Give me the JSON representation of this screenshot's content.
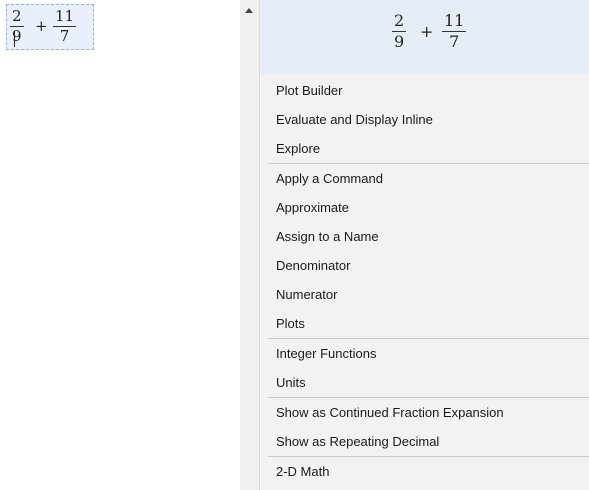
{
  "expression": {
    "term1": {
      "numerator": "2",
      "denominator": "9"
    },
    "operator": "+",
    "term2": {
      "numerator": "11",
      "denominator": "7"
    }
  },
  "menu": {
    "groups": [
      [
        "Plot Builder",
        "Evaluate and Display Inline",
        "Explore"
      ],
      [
        "Apply a Command",
        "Approximate",
        "Assign to a Name",
        "Denominator",
        "Numerator",
        "Plots"
      ],
      [
        "Integer Functions",
        "Units"
      ],
      [
        "Show as Continued Fraction Expansion",
        "Show as Repeating Decimal"
      ],
      [
        "2-D Math"
      ]
    ]
  },
  "colors": {
    "selection_bg": "#e9f0fb",
    "preview_bg": "#e6edf7",
    "menu_bg": "#f2f2f2",
    "separator": "#c9c9c9"
  }
}
